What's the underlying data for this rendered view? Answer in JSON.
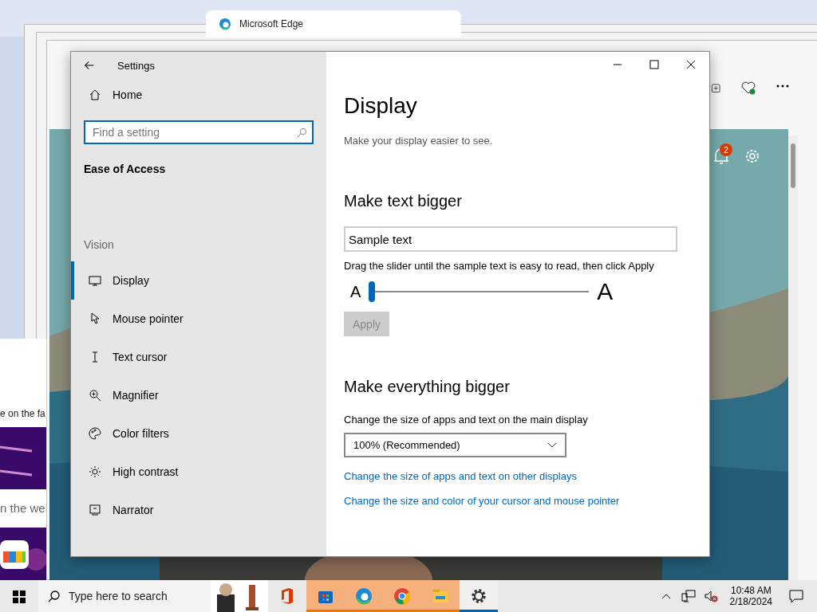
{
  "browser": {
    "tab_title": "Microsoft Edge",
    "notification_count": "2",
    "page_snippets": [
      "e on the fa",
      "n the wel"
    ]
  },
  "settings": {
    "title": "Settings",
    "home": "Home",
    "search": {
      "placeholder": "Find a setting"
    },
    "category": "Ease of Access",
    "group": "Vision",
    "nav": [
      {
        "label": "Display",
        "selected": true
      },
      {
        "label": "Mouse pointer",
        "selected": false
      },
      {
        "label": "Text cursor",
        "selected": false
      },
      {
        "label": "Magnifier",
        "selected": false
      },
      {
        "label": "Color filters",
        "selected": false
      },
      {
        "label": "High contrast",
        "selected": false
      },
      {
        "label": "Narrator",
        "selected": false
      }
    ],
    "page_title": "Display",
    "page_subtitle": "Make your display easier to see.",
    "text_section": {
      "heading": "Make text bigger",
      "sample": "Sample text",
      "instructions": "Drag the slider until the sample text is easy to read, then click Apply",
      "small_a": "A",
      "large_a": "A",
      "level": 0,
      "apply": {
        "label": "Apply",
        "disabled": true
      }
    },
    "scale_section": {
      "heading": "Make everything bigger",
      "label": "Change the size of apps and text on the main display",
      "value": "100% (Recommended)",
      "links": [
        "Change the size of apps and text on other displays",
        "Change the size and color of your cursor and mouse pointer"
      ]
    }
  },
  "taskbar": {
    "search_placeholder": "Type here to search",
    "apps": [
      {
        "kind": "office",
        "highlighted": false,
        "active": false
      },
      {
        "kind": "store",
        "highlighted": true,
        "active": false
      },
      {
        "kind": "edge",
        "highlighted": true,
        "active": false
      },
      {
        "kind": "chrome",
        "highlighted": true,
        "active": false
      },
      {
        "kind": "explorer",
        "highlighted": true,
        "active": false
      },
      {
        "kind": "settings",
        "highlighted": false,
        "active": true
      }
    ],
    "time": "10:48 AM",
    "date": "2/18/2024"
  }
}
